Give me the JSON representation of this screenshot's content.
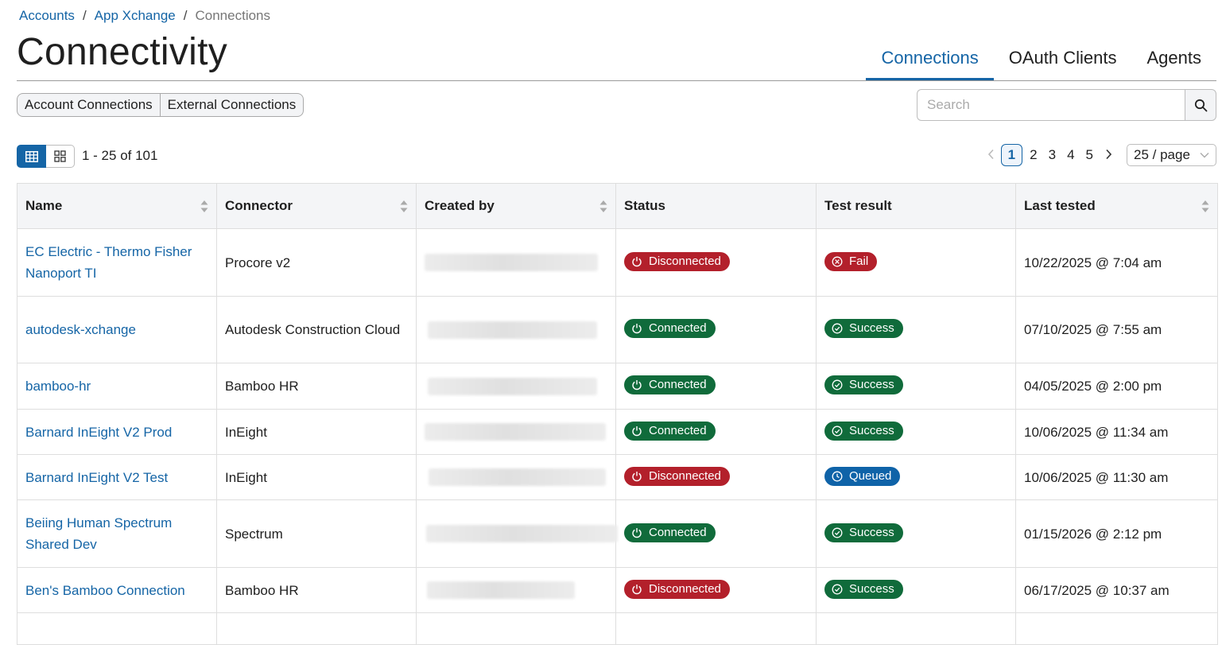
{
  "breadcrumb": {
    "items": [
      "Accounts",
      "App Xchange",
      "Connections"
    ],
    "separator": "/"
  },
  "page": {
    "title": "Connectivity"
  },
  "tabs": [
    {
      "label": "Connections",
      "active": true
    },
    {
      "label": "OAuth Clients",
      "active": false
    },
    {
      "label": "Agents",
      "active": false
    }
  ],
  "segment": {
    "account": "Account Connections",
    "external": "External Connections"
  },
  "search": {
    "placeholder": "Search"
  },
  "results": {
    "range": "1 - 25 of 101"
  },
  "pagination": {
    "pages": [
      "1",
      "2",
      "3",
      "4",
      "5"
    ],
    "current": "1",
    "per_page": "25 / page"
  },
  "table": {
    "headers": [
      "Name",
      "Connector",
      "Created by",
      "Status",
      "Test result",
      "Last tested"
    ],
    "rows": [
      {
        "name": " EC Electric - Thermo Fisher Nanoport TI",
        "connector": "Procore v2",
        "status": "Disconnected",
        "test": "Fail",
        "last": "10/22/2025 @ 7:04 am"
      },
      {
        "name": "autodesk-xchange",
        "connector": "Autodesk Construction Cloud",
        "status": "Connected",
        "test": "Success",
        "last": "07/10/2025 @ 7:55 am"
      },
      {
        "name": "bamboo-hr",
        "connector": "Bamboo HR",
        "status": "Connected",
        "test": "Success",
        "last": "04/05/2025 @ 2:00 pm"
      },
      {
        "name": "Barnard InEight V2 Prod",
        "connector": "InEight",
        "status": "Connected",
        "test": "Success",
        "last": "10/06/2025 @ 11:34 am"
      },
      {
        "name": "Barnard InEight V2 Test",
        "connector": "InEight",
        "status": "Disconnected",
        "test": "Queued",
        "last": "10/06/2025 @ 11:30 am"
      },
      {
        "name": "Beiing Human Spectrum Shared Dev",
        "connector": "Spectrum",
        "status": "Connected",
        "test": "Success",
        "last": "01/15/2026 @ 2:12 pm"
      },
      {
        "name": "Ben's Bamboo Connection",
        "connector": "Bamboo HR",
        "status": "Disconnected",
        "test": "Success",
        "last": "06/17/2025 @ 10:37 am"
      }
    ]
  },
  "colors": {
    "link": "#1565a6",
    "disconnected": "#b3202b",
    "connected": "#106b3b",
    "queued": "#0f63a8"
  }
}
